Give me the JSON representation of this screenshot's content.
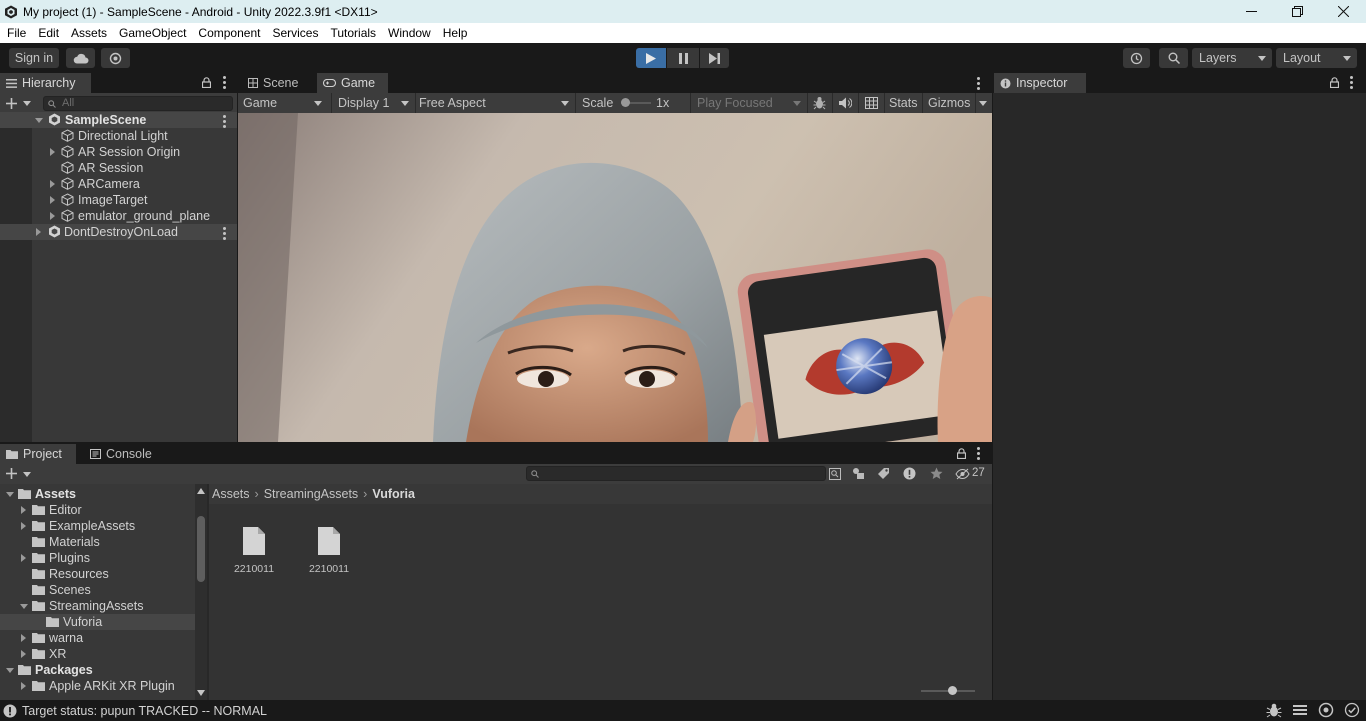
{
  "window": {
    "title": "My project (1) - SampleScene - Android - Unity 2022.3.9f1 <DX11>",
    "controls": [
      "minimize",
      "maximize",
      "close"
    ]
  },
  "menu": [
    "File",
    "Edit",
    "Assets",
    "GameObject",
    "Component",
    "Services",
    "Tutorials",
    "Window",
    "Help"
  ],
  "toolbar": {
    "sign_in": "Sign in",
    "layers": "Layers",
    "layout": "Layout",
    "accent": "#3a6ea5"
  },
  "hierarchy": {
    "tab": "Hierarchy",
    "search_placeholder": "All",
    "scene": "SampleScene",
    "items": [
      {
        "label": "Directional Light",
        "foldable": false
      },
      {
        "label": "AR Session Origin",
        "foldable": true
      },
      {
        "label": "AR Session",
        "foldable": false
      },
      {
        "label": "ARCamera",
        "foldable": true
      },
      {
        "label": "ImageTarget",
        "foldable": true
      },
      {
        "label": "emulator_ground_plane",
        "foldable": true
      }
    ],
    "dont_destroy": "DontDestroyOnLoad"
  },
  "scene_tab": "Scene",
  "game_tab": "Game",
  "game_bar": {
    "mode": "Game",
    "display": "Display 1",
    "aspect": "Free Aspect",
    "scale_label": "Scale",
    "scale_value": "1x",
    "play_mode": "Play Focused",
    "stats": "Stats",
    "gizmos": "Gizmos"
  },
  "inspector": {
    "tab": "Inspector"
  },
  "project": {
    "tab": "Project",
    "console_tab": "Console",
    "hidden_count": "27",
    "breadcrumb": [
      "Assets",
      "StreamingAssets",
      "Vuforia"
    ],
    "assets": [
      {
        "name": "2210011"
      },
      {
        "name": "2210011"
      }
    ],
    "tree": [
      {
        "label": "Assets",
        "level": 0,
        "fold": "down",
        "bold": true
      },
      {
        "label": "Editor",
        "level": 1,
        "fold": "right"
      },
      {
        "label": "ExampleAssets",
        "level": 1,
        "fold": "right"
      },
      {
        "label": "Materials",
        "level": 1,
        "fold": "none"
      },
      {
        "label": "Plugins",
        "level": 1,
        "fold": "right"
      },
      {
        "label": "Resources",
        "level": 1,
        "fold": "none"
      },
      {
        "label": "Scenes",
        "level": 1,
        "fold": "none"
      },
      {
        "label": "StreamingAssets",
        "level": 1,
        "fold": "down"
      },
      {
        "label": "Vuforia",
        "level": 2,
        "fold": "none",
        "selected": true
      },
      {
        "label": "warna",
        "level": 1,
        "fold": "right"
      },
      {
        "label": "XR",
        "level": 1,
        "fold": "right"
      },
      {
        "label": "Packages",
        "level": 0,
        "fold": "down",
        "bold": true
      },
      {
        "label": "Apple ARKit XR Plugin",
        "level": 1,
        "fold": "right"
      }
    ]
  },
  "status": {
    "message": "Target status: pupun TRACKED -- NORMAL"
  }
}
